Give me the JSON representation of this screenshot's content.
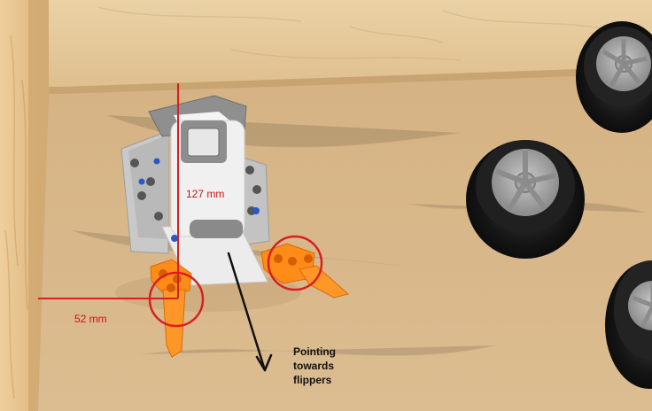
{
  "annotations": {
    "height_label": "127 mm",
    "width_label": "52 mm",
    "direction_line1": "Pointing",
    "direction_line2": "towards",
    "direction_line3": "flippers"
  },
  "colors": {
    "wood_panel": "#e5c18f",
    "board_floor": "#d8b688",
    "annotation_red": "#d92020",
    "arrow_black": "#111111",
    "brick_gray": "#b8b8b8",
    "tyre_black": "#1c1c1c",
    "rim_gray": "#a7a7a7",
    "flipper_orange": "#ff8a16"
  }
}
